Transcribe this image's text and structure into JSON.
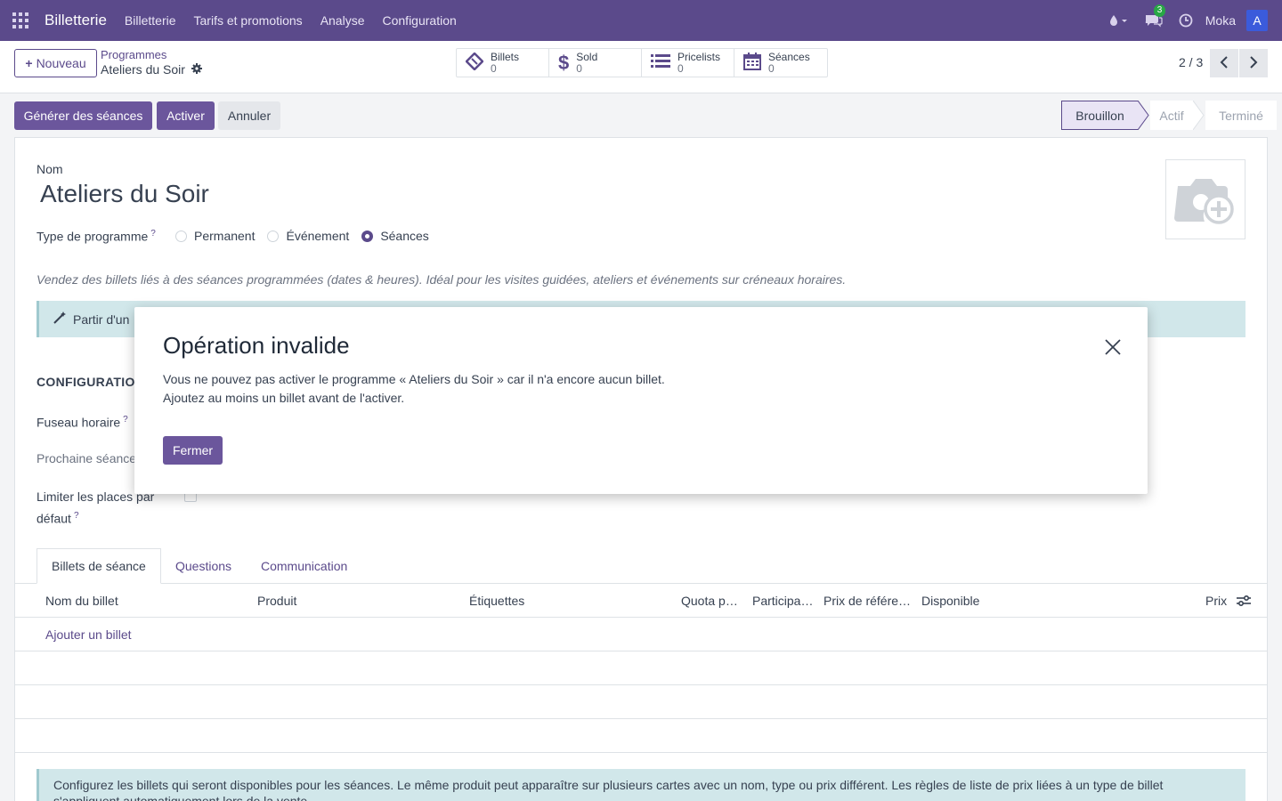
{
  "navbar": {
    "brand": "Billetterie",
    "menus": [
      "Billetterie",
      "Tarifs et promotions",
      "Analyse",
      "Configuration"
    ],
    "message_count": "3",
    "user": "Moka",
    "avatar_letter": "A",
    "color": "#5b4a8b"
  },
  "control": {
    "new_label": "Nouveau",
    "breadcrumb": "Programmes",
    "record": "Ateliers du Soir",
    "stats": [
      {
        "label": "Billets",
        "value": "0",
        "icon": "ticket-icon"
      },
      {
        "label": "Sold",
        "value": "0",
        "icon": "dollar-icon"
      },
      {
        "label": "Pricelists",
        "value": "0",
        "icon": "list-icon"
      },
      {
        "label": "Séances",
        "value": "0",
        "icon": "calendar-icon"
      }
    ],
    "pager": "2 / 3"
  },
  "actions": {
    "generate": "Générer des séances",
    "activate": "Activer",
    "cancel": "Annuler"
  },
  "stages": [
    "Brouillon",
    "Actif",
    "Terminé"
  ],
  "form": {
    "name_label": "Nom",
    "name_value": "Ateliers du Soir",
    "type_label": "Type de programme",
    "type_options": [
      "Permanent",
      "Événement",
      "Séances"
    ],
    "type_selected": "Séances",
    "description": "Vendez des billets liés à des séances programmées (dates & heures). Idéal pour les visites guidées, ateliers et événements sur créneaux horaires.",
    "banner": "Partir d'un",
    "section": "CONFIGURATION",
    "timezone_label": "Fuseau horaire",
    "next_session_label": "Prochaine séance",
    "limit_label_1": "Limiter les places par",
    "limit_label_2": "défaut"
  },
  "tabs": [
    "Billets de séance",
    "Questions",
    "Communication"
  ],
  "table": {
    "headers": [
      "Nom du billet",
      "Produit",
      "Étiquettes",
      "Quota p…",
      "Participa…",
      "Prix de référe…",
      "Disponible",
      "Prix"
    ],
    "add_line": "Ajouter un billet"
  },
  "info": {
    "line1": "Configurez les billets qui seront disponibles pour les séances. Le même produit peut apparaître sur plusieurs cartes avec un nom, type ou prix différent. Les règles de liste de prix liées à un type de billet",
    "line2": "s'appliquent automatiquement lors de la vente."
  },
  "modal": {
    "title": "Opération invalide",
    "line1": "Vous ne pouvez pas activer le programme « Ateliers du Soir » car il n'a encore aucun billet.",
    "line2": "Ajoutez au moins un billet avant de l'activer.",
    "close_button": "Fermer"
  }
}
